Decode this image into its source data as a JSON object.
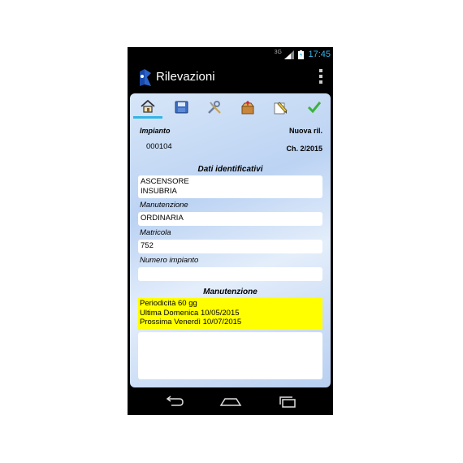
{
  "status": {
    "time": "17:45",
    "network": "3G"
  },
  "app": {
    "title": "Rilevazioni"
  },
  "tabs": [
    {
      "name": "home-icon"
    },
    {
      "name": "save-icon"
    },
    {
      "name": "tools-icon"
    },
    {
      "name": "box-icon"
    },
    {
      "name": "edit-icon"
    },
    {
      "name": "check-icon"
    }
  ],
  "header": {
    "impianto_label": "Impianto",
    "impianto_value": "000104",
    "nuova_label": "Nuova ril.",
    "ch_value": "Ch. 2/2015"
  },
  "dati": {
    "section_title": "Dati identificativi",
    "name_line1": "ASCENSORE",
    "name_line2": "INSUBRIA",
    "manutenzione_label": "Manutenzione",
    "manutenzione_value": "ORDINARIA",
    "matricola_label": "Matricola",
    "matricola_value": "752",
    "numero_label": "Numero impianto",
    "numero_value": ""
  },
  "manutenzione": {
    "section_title": "Manutenzione",
    "line1": "Periodicità 60 gg",
    "line2": "Ultima Domenica 10/05/2015",
    "line3": "Prossima Venerdì 10/07/2015"
  },
  "colors": {
    "accent": "#33b5e5",
    "highlight": "#ffff00"
  }
}
